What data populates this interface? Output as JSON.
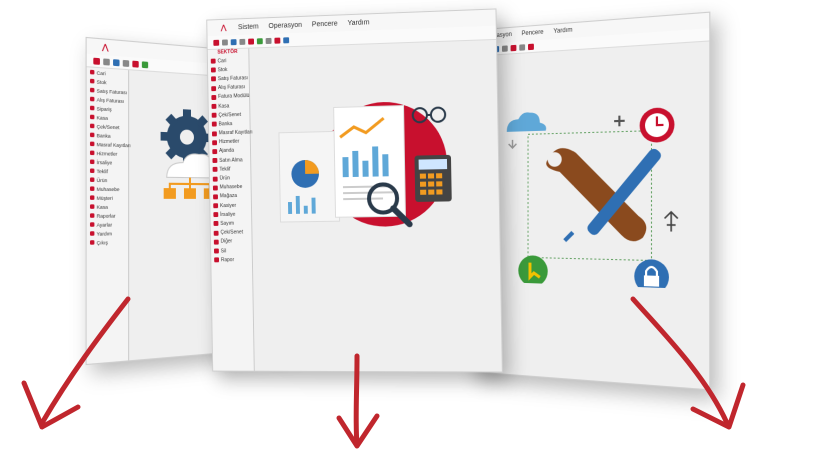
{
  "left_window": {
    "menu": [
      "",
      "",
      ""
    ],
    "sidebar_header": "",
    "sidebar_items": [
      "Cari",
      "Stok",
      "Satış Faturası",
      "Alış Faturası",
      "Sipariş",
      "Kasa",
      "Çek/Senet",
      "Banka",
      "Masraf Kayıtları",
      "Hizmetler",
      "İrsaliye",
      "Teklif",
      "Ürün",
      "Muhasebe",
      "Müşteri",
      "Kasa",
      "Raporlar",
      "Ayarlar",
      "Yardım",
      "Çıkış"
    ]
  },
  "middle_window": {
    "menu": [
      "Sistem",
      "Operasyon",
      "Pencere",
      "Yardım"
    ],
    "sidebar_header": "SEKTÖR",
    "sidebar_items": [
      "Cari",
      "Stok",
      "Satış Faturası",
      "Alış Faturası",
      "Fatura Modülü",
      "Kasa",
      "Çek/Senet",
      "Banka",
      "Masraf Kayıtları",
      "Hizmetler",
      "Ajanda",
      "Satın Alma",
      "Teklif",
      "Ürün",
      "Muhasebe",
      "Mağaza",
      "Kasiyer",
      "İrsaliye",
      "Sayım",
      "Çek/Senet",
      "Diğer",
      "Sil",
      "Rapor"
    ]
  },
  "right_window": {
    "menu": [
      "Operasyon",
      "Pencere",
      "Yardım"
    ]
  },
  "colors": {
    "accent": "#c8102e",
    "blue": "#2f6fb3",
    "orange": "#f29b20"
  },
  "icons": [
    "gears-icon",
    "cloud-icon",
    "report-illustration-icon",
    "tools-icon",
    "clock-icon",
    "lock-icon",
    "usb-icon",
    "cursor-icon",
    "down-arrow-icon"
  ]
}
